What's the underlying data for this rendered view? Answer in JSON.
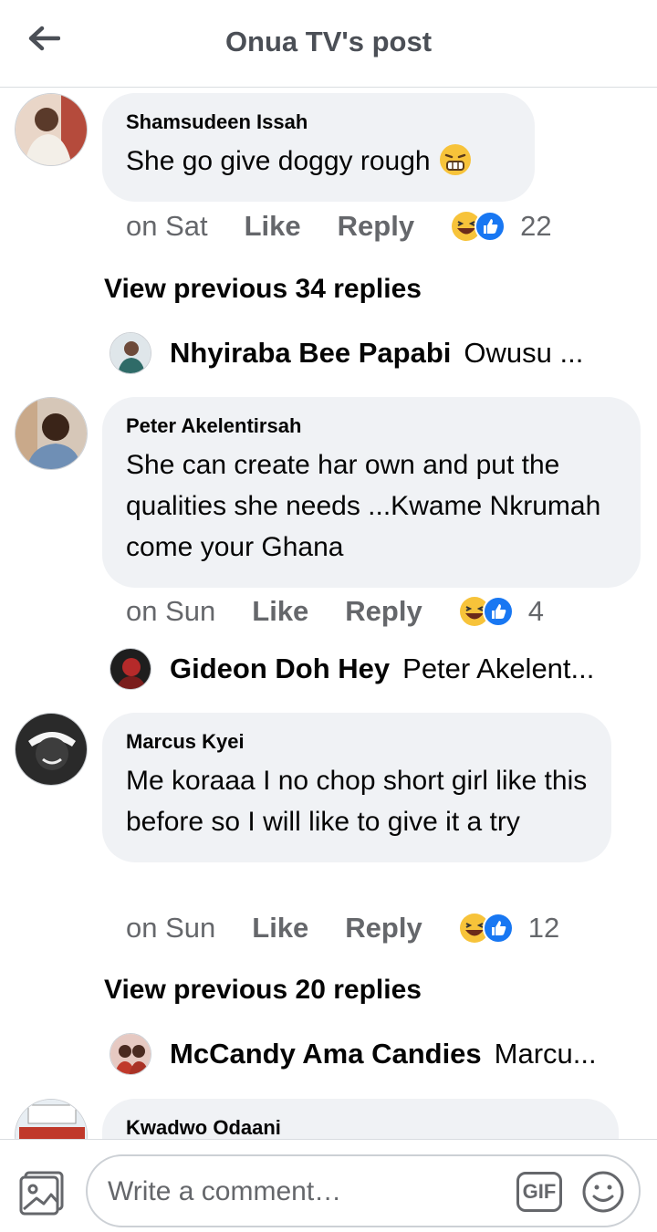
{
  "header": {
    "title": "Onua TV's post"
  },
  "comments": [
    {
      "author": "Shamsudeen Issah",
      "text": "She go give doggy rough",
      "time": "on Sat",
      "like": "Like",
      "reply": "Reply",
      "reaction_count": "22"
    },
    {
      "author": "Peter Akelentirsah",
      "text": "She can create har own and put the qualities she needs ...Kwame Nkrumah come your Ghana",
      "time": "on Sun",
      "like": "Like",
      "reply": "Reply",
      "reaction_count": "4"
    },
    {
      "author": "Marcus Kyei",
      "text": "Me koraaa I no chop short girl like this before so I will like to give it a try",
      "time": "on Sun",
      "like": "Like",
      "reply": "Reply",
      "reaction_count": "12"
    },
    {
      "author": "Kwadwo Odaani"
    }
  ],
  "view_previous": [
    "View previous 34 replies",
    "View previous 20 replies"
  ],
  "replies": [
    {
      "name": "Nhyiraba Bee Papabi",
      "preview": "Owusu ..."
    },
    {
      "name": "Gideon Doh Hey",
      "preview": "Peter Akelent..."
    },
    {
      "name": "McCandy Ama Candies",
      "preview": "Marcu..."
    }
  ],
  "composer": {
    "placeholder": "Write a comment…",
    "gif_label": "GIF"
  },
  "icons": {
    "back": "back-arrow-icon",
    "reaction_haha": "haha-reaction-icon",
    "reaction_like": "like-reaction-icon",
    "photo": "photo-icon",
    "emoji": "emoji-icon",
    "grimace_emoji": "grimace-emoji-icon"
  },
  "colors": {
    "bubble": "#f0f2f5",
    "secondary_text": "#65676b",
    "like_blue": "#1877f2",
    "haha_yellow": "#f7c33a"
  }
}
